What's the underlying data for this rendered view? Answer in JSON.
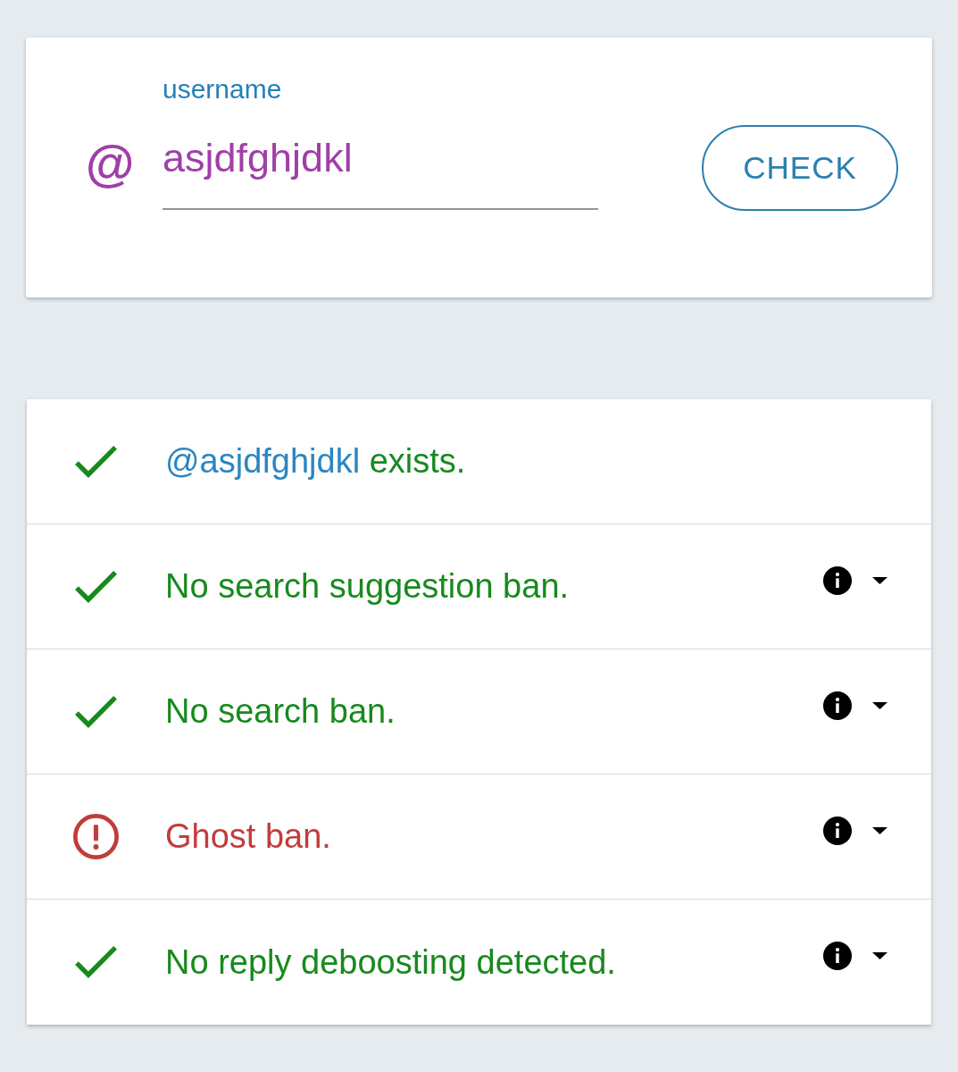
{
  "search": {
    "prefix": "@",
    "label": "username",
    "value": "asjdfghjdkl",
    "button": "CHECK"
  },
  "results": [
    {
      "kind": "account",
      "passed": true,
      "mention": "@asjdfghjdkl",
      "text": "exists."
    },
    {
      "kind": "check",
      "passed": true,
      "text": "No search suggestion ban.",
      "expanded": false
    },
    {
      "kind": "check",
      "passed": true,
      "text": "No search ban.",
      "expanded": false
    },
    {
      "kind": "check",
      "passed": false,
      "text": "Ghost ban.",
      "expanded": false
    },
    {
      "kind": "check",
      "passed": true,
      "text": "No reply deboosting detected.",
      "expanded": false
    }
  ]
}
